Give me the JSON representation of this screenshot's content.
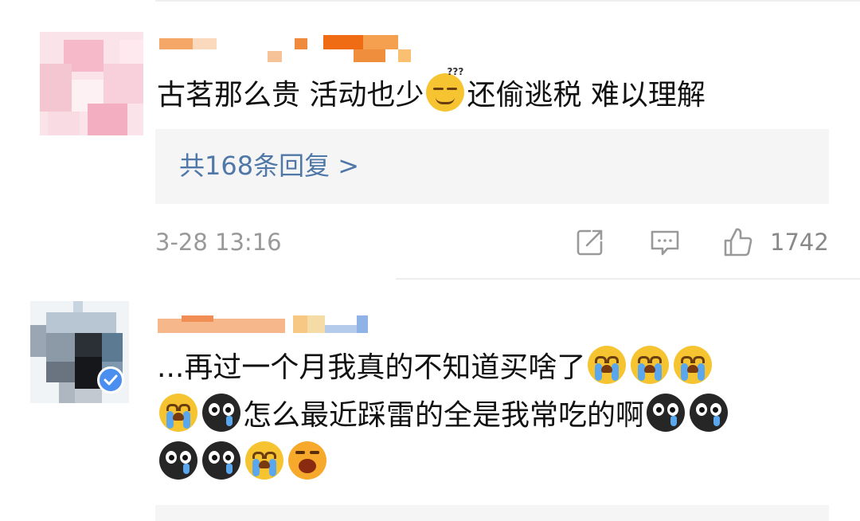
{
  "comments": [
    {
      "text_parts": [
        "古茗那么贵 活动也少",
        "还偷逃税 难以理解"
      ],
      "emoji_names": [
        "puzzled-emoji"
      ],
      "reply_summary": "共168条回复 >",
      "timestamp": "3-28 13:16",
      "like_count": "1742",
      "verified": false
    },
    {
      "text_line1": "...再过一个月我真的不知道买啥了",
      "text_line2": "怎么最近踩雷的全是我常吃的啊",
      "emoji_names": [
        "crying-emoji",
        "crying-emoji",
        "crying-emoji",
        "crying-emoji",
        "black-tear-emoji",
        "black-tear-emoji",
        "black-tear-emoji",
        "black-tear-emoji",
        "black-tear-emoji",
        "crying-emoji",
        "shouting-emoji"
      ],
      "verified": true
    }
  ],
  "icons": {
    "share": "share-icon",
    "comment": "comment-icon",
    "like": "thumbs-up-icon",
    "verified": "verified-check-icon"
  },
  "colors": {
    "reply_link": "#4f77a8",
    "meta_text": "#999999",
    "reply_box_bg": "#f5f5f5",
    "verified_badge": "#4a8ef0"
  }
}
